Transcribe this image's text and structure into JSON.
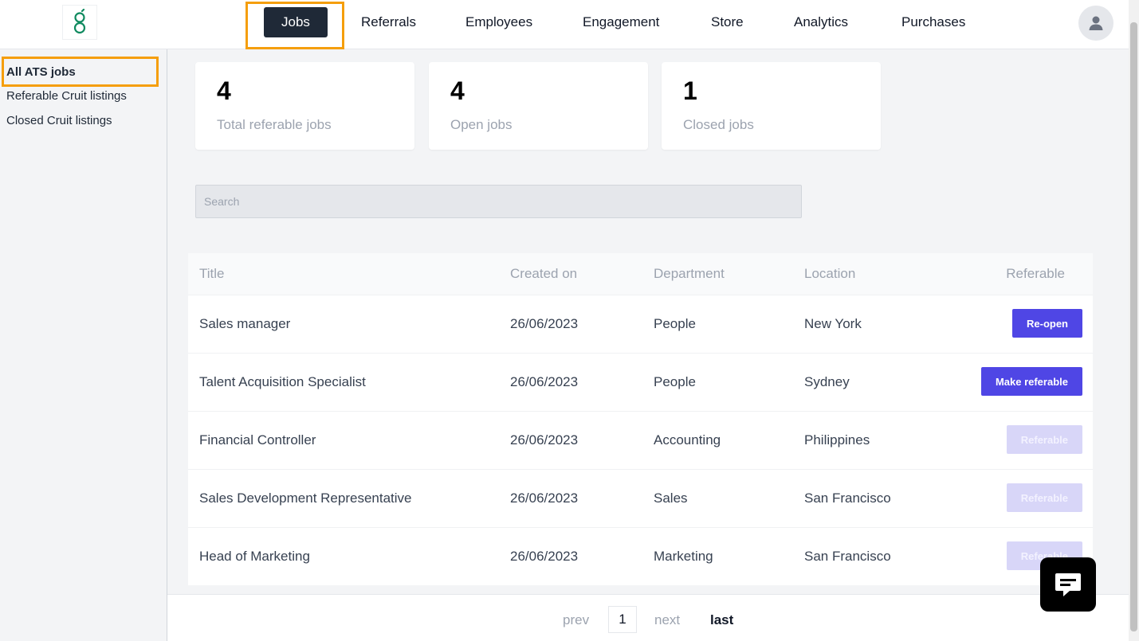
{
  "nav": {
    "items": [
      {
        "label": "Jobs",
        "active": true
      },
      {
        "label": "Referrals"
      },
      {
        "label": "Employees"
      },
      {
        "label": "Engagement"
      },
      {
        "label": "Store"
      },
      {
        "label": "Analytics"
      },
      {
        "label": "Purchases"
      }
    ],
    "logo_icon": "greenhouse-g-logo",
    "avatar_icon": "user-icon"
  },
  "sidebar": {
    "items": [
      {
        "label": "All ATS jobs",
        "active": true
      },
      {
        "label": "Referable Cruit listings"
      },
      {
        "label": "Closed Cruit listings"
      }
    ]
  },
  "stats": [
    {
      "value": "4",
      "label": "Total referable jobs"
    },
    {
      "value": "4",
      "label": "Open jobs"
    },
    {
      "value": "1",
      "label": "Closed jobs"
    }
  ],
  "search": {
    "placeholder": "Search",
    "value": ""
  },
  "table": {
    "headers": [
      "Title",
      "Created on",
      "Department",
      "Location",
      "Referable"
    ],
    "rows": [
      {
        "title": "Sales manager",
        "created": "26/06/2023",
        "department": "People",
        "location": "New York",
        "action": "Re-open",
        "enabled": true
      },
      {
        "title": "Talent Acquisition Specialist",
        "created": "26/06/2023",
        "department": "People",
        "location": "Sydney",
        "action": "Make referable",
        "enabled": true
      },
      {
        "title": "Financial Controller",
        "created": "26/06/2023",
        "department": "Accounting",
        "location": "Philippines",
        "action": "Referable",
        "enabled": false
      },
      {
        "title": "Sales Development Representative",
        "created": "26/06/2023",
        "department": "Sales",
        "location": "San Francisco",
        "action": "Referable",
        "enabled": false
      },
      {
        "title": "Head of Marketing",
        "created": "26/06/2023",
        "department": "Marketing",
        "location": "San Francisco",
        "action": "Referable",
        "enabled": false
      }
    ]
  },
  "pagination": {
    "prev": "prev",
    "page": "1",
    "next": "next",
    "last": "last"
  },
  "colors": {
    "accent": "#4f46e5",
    "nav_active": "#1f2937",
    "highlight": "#f59e0b"
  }
}
